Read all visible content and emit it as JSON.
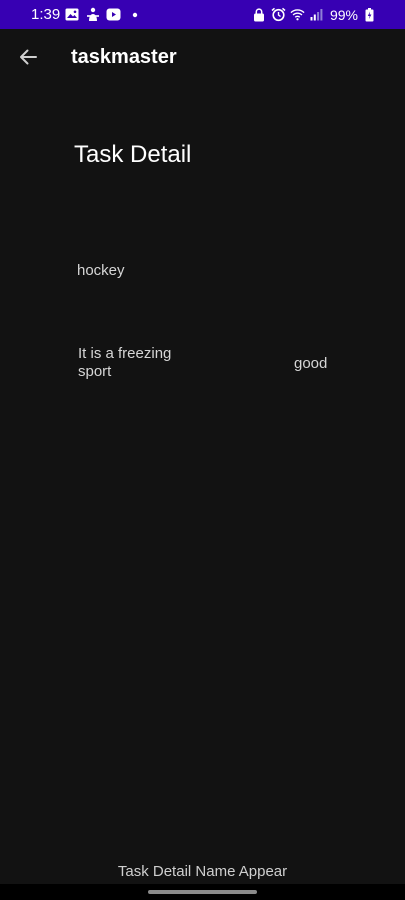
{
  "status_bar": {
    "time": "1:39",
    "battery": "99%",
    "background_color": "#3700b3",
    "left_icons": [
      "gallery-icon",
      "accessibility-icon",
      "youtube-icon",
      "dot-icon"
    ],
    "right_icons": [
      "lock-icon",
      "alarm-icon",
      "wifi-icon",
      "signal-icon",
      "battery-icon"
    ]
  },
  "app_bar": {
    "title": "taskmaster",
    "back_icon": "arrow-back-icon"
  },
  "page": {
    "heading": "Task Detail",
    "task_title": "hockey",
    "task_body": "It is a freezing sport",
    "task_state": "good",
    "footer": "Task Detail Name Appear"
  },
  "colors": {
    "background": "#121212",
    "text_primary": "#ffffff",
    "text_secondary": "#d6d6d6"
  }
}
